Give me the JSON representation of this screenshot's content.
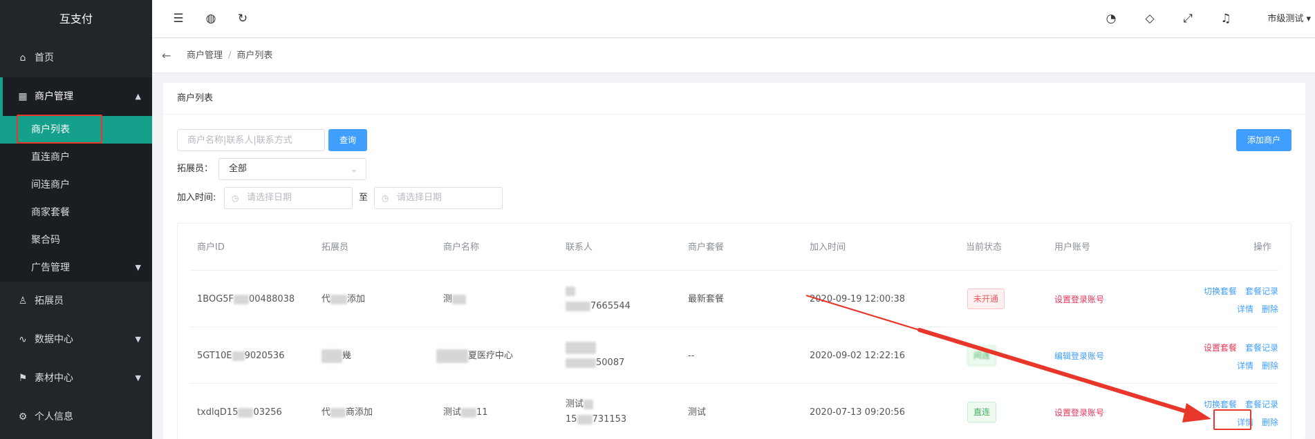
{
  "app": {
    "brand": "互支付",
    "user": "市级测试"
  },
  "sidebar": {
    "home": "首页",
    "merchant_mgmt": "商户管理",
    "sub": [
      "商户列表",
      "直连商户",
      "间连商户",
      "商家套餐",
      "聚合码",
      "广告管理"
    ],
    "expander": "拓展员",
    "data_center": "数据中心",
    "material_center": "素材中心",
    "profile": "个人信息"
  },
  "breadcrumb": {
    "level1": "商户管理",
    "level2": "商户列表"
  },
  "panel": {
    "title": "商户列表"
  },
  "filters": {
    "search_placeholder": "商户名称|联系人|联系方式",
    "query_button": "查询",
    "add_button": "添加商户",
    "expander_label": "拓展员：",
    "expander_value": "全部",
    "join_time_label": "加入时间:",
    "date_placeholder": "请选择日期",
    "to_label": "至"
  },
  "table": {
    "headers": [
      "商户ID",
      "拓展员",
      "商户名称",
      "联系人",
      "商户套餐",
      "加入时间",
      "当前状态",
      "用户账号",
      "操作"
    ],
    "rows": [
      {
        "id_prefix": "1BOG5F",
        "id_suffix": "00488038",
        "expander_prefix": "代",
        "expander_suffix": "添加",
        "name_prefix": "测",
        "name_suffix": "",
        "contact_name": "",
        "phone_suffix": "7665544",
        "package": "最新套餐",
        "join_time": "2020-09-19 12:00:38",
        "status": "未开通",
        "account_action": "设置登录账号",
        "actions": [
          "切换套餐",
          "套餐记录",
          "详情",
          "删除"
        ]
      },
      {
        "id_prefix": "5GT10E",
        "id_suffix": "9020536",
        "expander_prefix": "",
        "expander_suffix": "幾",
        "name_prefix": "",
        "name_suffix": "夏医疗中心",
        "contact_name": "",
        "phone_suffix": "50087",
        "package": "--",
        "join_time": "2020-09-02 12:22:16",
        "status": "间连",
        "account_action": "编辑登录账号",
        "actions": [
          "设置套餐",
          "套餐记录",
          "详情",
          "删除"
        ]
      },
      {
        "id_prefix": "txdlqD15",
        "id_suffix": "03256",
        "expander_prefix": "代",
        "expander_suffix": "商添加",
        "name_prefix": "测试",
        "name_suffix": "11",
        "contact_name": "测试",
        "phone_prefix": "15",
        "phone_suffix": "731153",
        "package": "测试",
        "join_time": "2020-07-13 09:20:56",
        "status": "直连",
        "account_action": "设置登录账号",
        "actions": [
          "切换套餐",
          "套餐记录",
          "详情",
          "删除"
        ]
      }
    ]
  },
  "colors": {
    "accent": "#15a08c",
    "primary": "#409eff",
    "danger": "#e8365a",
    "sidebar_bg": "#22262b",
    "annotation": "#e8362a"
  },
  "icons": {
    "menu": "menu-fold-icon",
    "globe": "globe-icon",
    "refresh": "refresh-icon",
    "palette": "palette-icon",
    "tag": "tag-icon",
    "fullscreen": "fullscreen-icon",
    "bell": "bell-icon",
    "home": "home-icon",
    "grid": "grid-icon",
    "user": "user-icon",
    "chart": "chart-icon",
    "flag": "flag-icon",
    "gear": "gear-icon"
  }
}
